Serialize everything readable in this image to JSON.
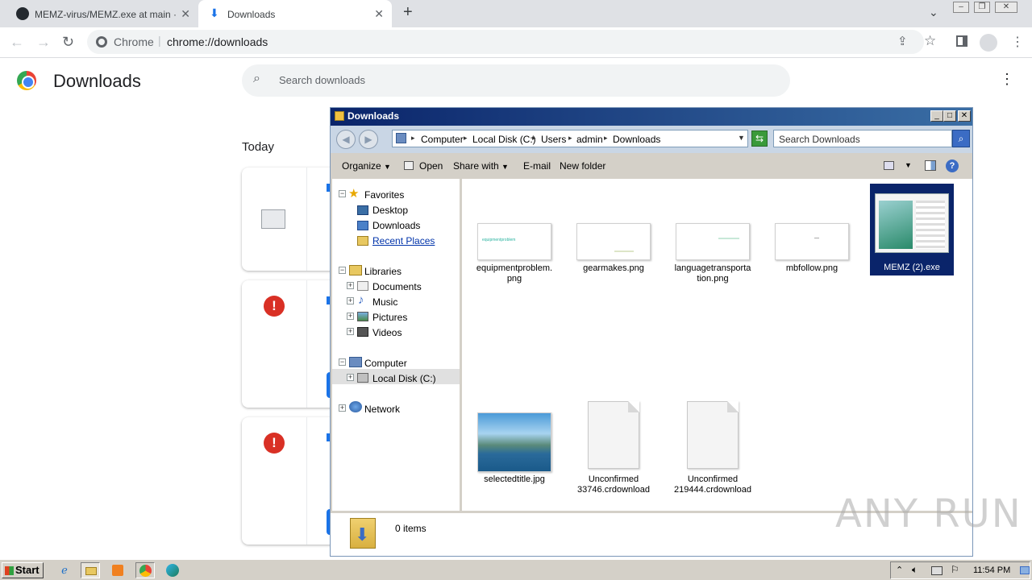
{
  "browser": {
    "tabs": [
      {
        "title": "MEMZ-virus/MEMZ.exe at main · Dfm",
        "active": false
      },
      {
        "title": "Downloads",
        "active": true
      }
    ],
    "new_tab_label": "+",
    "omnibox": {
      "scheme_label": "Chrome",
      "url": "chrome://downloads"
    }
  },
  "downloads_page": {
    "title": "Downloads",
    "search_placeholder": "Search downloads",
    "section_today": "Today",
    "card_error_icon": "!"
  },
  "explorer": {
    "title": "Downloads",
    "breadcrumbs": [
      "Computer",
      "Local Disk (C:)",
      "Users",
      "admin",
      "Downloads"
    ],
    "search_placeholder": "Search Downloads",
    "commands": {
      "organize": "Organize",
      "open": "Open",
      "share_with": "Share with",
      "email": "E-mail",
      "new_folder": "New folder"
    },
    "nav": {
      "favorites": "Favorites",
      "desktop": "Desktop",
      "downloads": "Downloads",
      "recent_places": "Recent Places",
      "libraries": "Libraries",
      "documents": "Documents",
      "music": "Music",
      "pictures": "Pictures",
      "videos": "Videos",
      "computer": "Computer",
      "local_disk": "Local Disk (C:)",
      "network": "Network"
    },
    "files": [
      {
        "name": "equipmentproblem.png",
        "thumb_text": "equipmentproblem",
        "line1": "equipmentproblem.",
        "line2": "png"
      },
      {
        "name": "gearmakes.png",
        "line1": "gearmakes.png",
        "line2": ""
      },
      {
        "name": "languagetransportation.png",
        "line1": "languagetransporta",
        "line2": "tion.png"
      },
      {
        "name": "mbfollow.png",
        "line1": "mbfollow.png",
        "line2": ""
      },
      {
        "name": "MEMZ (2).exe",
        "line1": "MEMZ (2).exe",
        "line2": "",
        "selected": true
      },
      {
        "name": "selectedtitle.jpg",
        "line1": "selectedtitle.jpg",
        "line2": ""
      },
      {
        "name": "Unconfirmed 33746.crdownload",
        "line1": "Unconfirmed",
        "line2": "33746.crdownload"
      },
      {
        "name": "Unconfirmed 219444.crdownload",
        "line1": "Unconfirmed",
        "line2": "219444.crdownload"
      }
    ],
    "status": "0 items"
  },
  "taskbar": {
    "start_label": "Start",
    "clock": "11:54 PM"
  },
  "watermark": "ANY RUN",
  "colors": {
    "selection": "#0a246a",
    "chrome_tabstrip": "#dfe1e5",
    "error_red": "#d93025",
    "accent_blue": "#1a73e8"
  }
}
